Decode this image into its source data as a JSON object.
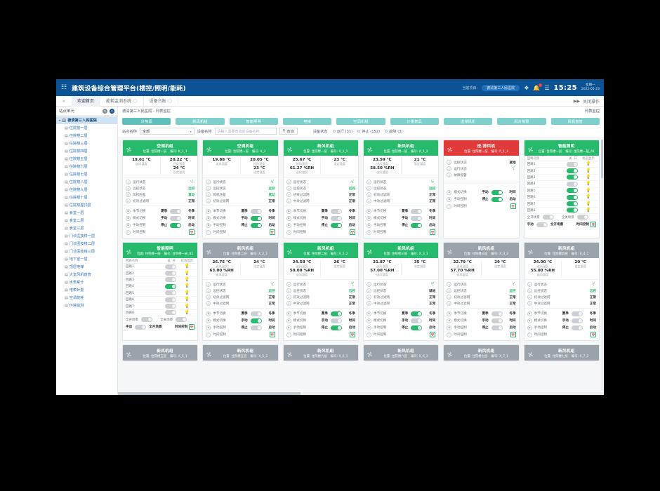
{
  "topbar": {
    "menu_icon": "menu-icon",
    "title": "建筑设备综合管理平台(楼控/照明/能耗)",
    "project_label": "当前项目:",
    "project_name": "德清第三人民医院",
    "fullscreen_icon": "fullscreen-icon",
    "bell_icon": "bell-icon",
    "list_icon": "list-icon",
    "clock": "15:25",
    "weekday": "星期一",
    "date": "2022-05-23"
  },
  "tabstrip": {
    "collapse_icon": "collapse-left-icon",
    "tabs": [
      {
        "label": "欢迎首页",
        "closable": false,
        "active": true
      },
      {
        "label": "能耗监测系统",
        "closable": true,
        "active": false
      },
      {
        "label": "设备台账",
        "closable": true,
        "active": false
      }
    ],
    "right_icon": "forward-icon",
    "right_label": "关闭操作"
  },
  "sidebar": {
    "header": "站点单元",
    "refresh_icon": "refresh-icon",
    "search_icon": "search-icon",
    "root": "德清第三人民医院",
    "items": [
      "住院楼一层",
      "住院楼二层",
      "住院楼三层",
      "住院楼四层",
      "住院楼五层",
      "住院楼六层",
      "住院楼七层",
      "住院楼八层",
      "住院楼九层",
      "住院楼十层",
      "住院楼屋顶层",
      "食堂一层",
      "食堂二层",
      "食堂三层",
      "门诊医技楼一层",
      "门诊医技楼二层",
      "门诊医技楼三层",
      "地下室一层",
      "顶层电梯",
      "大堂风机盘管",
      "水表累计",
      "电表计量",
      "空调能耗",
      "环境监测"
    ]
  },
  "breadcrumb": {
    "path": "德清第三人民医院 - 列表监控",
    "right": "列表监控"
  },
  "toolbar": {
    "categories": [
      {
        "label": "冷热源",
        "selected": true
      },
      {
        "label": "新风机组",
        "selected": false
      },
      {
        "label": "智能照明",
        "selected": false
      },
      {
        "label": "电梯",
        "selected": false
      },
      {
        "label": "空调机组",
        "selected": false
      },
      {
        "label": "计量表具",
        "selected": false
      },
      {
        "label": "送排风机",
        "selected": false
      },
      {
        "label": "风冷热泵",
        "selected": false
      },
      {
        "label": "风机盘管",
        "selected": false
      }
    ],
    "site_label": "站点名称",
    "site_value": "全部",
    "device_label": "设备名称",
    "device_placeholder": "请输入需要查询的设备名称",
    "search_button": "查询",
    "search_icon": "search-icon",
    "status_label": "设备状态",
    "statuses": [
      {
        "label": "运行 (31)"
      },
      {
        "label": "停止 (152)"
      },
      {
        "label": "故障 (3)"
      }
    ]
  },
  "labels": {
    "pos": "位置:",
    "code": "编号:",
    "supply_temp": "送风温度",
    "return_temp": "回风温度",
    "set_temp": "设定温度",
    "supply_hum": "送风湿度",
    "run_state": "运行状态",
    "remote_state": "远控状态",
    "fan_press": "风机压差",
    "primary_filter": "初效过滤网",
    "medium_filter": "中效过滤网",
    "fault_alarm": "故障报警",
    "season_switch": "季节切换",
    "mode_switch": "模式切换",
    "manual_ctrl": "手动控制",
    "time_ctrl": "时间控制",
    "summer": "夏季",
    "winter": "冬季",
    "manual": "手动",
    "timed": "时间",
    "stop": "停止",
    "start": "启动",
    "loop_name": "回路名称",
    "off": "关",
    "on": "开",
    "state_display": "状态显示",
    "all_on_scene": "全开场景",
    "all_off_scene": "全关场景"
  },
  "cards_row1": [
    {
      "kind": "ahu",
      "title": "空调机组",
      "headerColor": "green",
      "pos": "住院楼一层",
      "code": "K_1_1",
      "t1": "19.61 ℃",
      "t1label": "送风温度",
      "t2": "20.22 ℃",
      "t2label": "回风温度",
      "t3": "24 ℃",
      "t3label": "设定温度",
      "run_icon": "fan-running-icon",
      "remote": "远控",
      "fanpress": "直动",
      "pfilter": "正常",
      "season_on": false,
      "mode_on": false,
      "manual_on": true
    },
    {
      "kind": "ahu",
      "title": "空调机组",
      "headerColor": "green",
      "pos": "住院楼一层",
      "code": "K_2",
      "t1": "19.88 ℃",
      "t1label": "送风温度",
      "t2": "20.05 ℃",
      "t2label": "回风温度",
      "t3": "23 ℃",
      "t3label": "设定温度",
      "run_icon": "fan-running-icon",
      "remote": "远控",
      "fanpress": "直动",
      "pfilter": "正常",
      "season_on": false,
      "mode_on": true,
      "manual_on": true
    },
    {
      "kind": "ahu2",
      "title": "新风机组",
      "headerColor": "green",
      "pos": "住院楼一层",
      "code": "X_1_1",
      "t1": "25.67 ℃",
      "t1label": "送风温度",
      "t1b": "61.27 %RH",
      "t1blabel": "送风湿度",
      "t3": "23 ℃",
      "t3label": "设定温度",
      "run_icon": "fan-running-icon",
      "remote": "远控",
      "pfilter": "正常",
      "mfilter": "正常",
      "season_on": false,
      "mode_on": false,
      "manual_on": true
    },
    {
      "kind": "ahu2",
      "title": "新风机组",
      "headerColor": "green",
      "pos": "住院楼一层",
      "code": "X_1_2",
      "t1": "23.59 ℃",
      "t1label": "送风温度",
      "t1b": "58.50 %RH",
      "t1blabel": "送风湿度",
      "t3": "21 ℃",
      "t3label": "设定温度",
      "run_icon": "fan-running-icon",
      "remote": "远控",
      "pfilter": "正常",
      "mfilter": "正常",
      "season_on": false,
      "mode_on": false,
      "manual_on": true
    },
    {
      "kind": "fan",
      "title": "送/排风机",
      "headerColor": "red",
      "pos": "住院楼一层",
      "code": "P_1_1",
      "remote": "就地",
      "run_icon": "fan-running-icon",
      "mode_on": true,
      "manual_on": true
    },
    {
      "kind": "light",
      "title": "智能照明",
      "headerColor": "green",
      "pos": "住院楼一层",
      "code": "住院楼一层_A1",
      "loops": [
        {
          "name": "回路1",
          "on": false,
          "lamp": false
        },
        {
          "name": "回路2",
          "on": true,
          "lamp": true
        },
        {
          "name": "回路3",
          "on": true,
          "lamp": true
        },
        {
          "name": "回路4",
          "on": false,
          "lamp": false
        },
        {
          "name": "回路5",
          "on": true,
          "lamp": true
        },
        {
          "name": "回路6",
          "on": true,
          "lamp": true
        },
        {
          "name": "回路7",
          "on": true,
          "lamp": true
        },
        {
          "name": "回路8",
          "on": true,
          "lamp": true
        }
      ],
      "scene_on": false,
      "scene_off": false,
      "manual_on": false
    }
  ],
  "cards_row2": [
    {
      "kind": "light",
      "title": "智能照明",
      "headerColor": "green",
      "pos": "住院楼一层",
      "code": "住院楼一层_B1",
      "loops": [
        {
          "name": "回路1",
          "on": false,
          "lamp": false
        },
        {
          "name": "回路2",
          "on": false,
          "lamp": false
        },
        {
          "name": "回路3",
          "on": false,
          "lamp": false
        },
        {
          "name": "回路4",
          "on": true,
          "lamp": true
        },
        {
          "name": "回路5",
          "on": false,
          "lamp": false
        },
        {
          "name": "回路6",
          "on": false,
          "lamp": false
        },
        {
          "name": "回路7",
          "on": false,
          "lamp": false
        },
        {
          "name": "回路8",
          "on": false,
          "lamp": false
        }
      ],
      "scene_on": false,
      "scene_off": false,
      "manual_on": false
    },
    {
      "kind": "ahu2",
      "title": "新风机组",
      "headerColor": "gray",
      "pos": "住院楼二层",
      "code": "X_2_1",
      "t1": "26.75 ℃",
      "t1label": "送风温度",
      "t1b": "63.00 %RH",
      "t1blabel": "送风湿度",
      "t3": "24 ℃",
      "t3label": "设定温度",
      "run_icon": "fan-stopped-icon",
      "remote": "远控",
      "pfilter": "正常",
      "mfilter": "正常",
      "season_on": false,
      "mode_on": true,
      "manual_on": false
    },
    {
      "kind": "ahu2",
      "title": "新风机组",
      "headerColor": "green",
      "pos": "住院楼二层",
      "code": "X_2_2",
      "t1": "24.58 ℃",
      "t1label": "送风温度",
      "t1b": "59.00 %RH",
      "t1blabel": "送风湿度",
      "t3": "26 ℃",
      "t3label": "设定温度",
      "run_icon": "fan-running-icon",
      "remote": "远控",
      "pfilter": "正常",
      "mfilter": "正常",
      "season_on": true,
      "mode_on": false,
      "manual_on": true
    },
    {
      "kind": "ahu2",
      "title": "新风机组",
      "headerColor": "green",
      "pos": "住院楼三层",
      "code": "X_3_1",
      "t1": "21.87 ℃",
      "t1label": "送风温度",
      "t1b": "57.00 %RH",
      "t1blabel": "送风湿度",
      "t3": "35 ℃",
      "t3label": "设定温度",
      "run_icon": "fan-running-icon",
      "remote": "就地",
      "pfilter": "正常",
      "mfilter": "正常",
      "season_on": true,
      "mode_on": false,
      "manual_on": true
    },
    {
      "kind": "ahu2",
      "title": "新风机组",
      "headerColor": "gray",
      "pos": "住院楼三层",
      "code": "X_3_2",
      "t1": "22.79 ℃",
      "t1label": "送风温度",
      "t1b": "57.70 %RH",
      "t1blabel": "送风湿度",
      "t3": "29 ℃",
      "t3label": "设定温度",
      "run_icon": "fan-stopped-icon",
      "remote": "远控",
      "pfilter": "正常",
      "mfilter": "正常",
      "season_on": false,
      "mode_on": false,
      "manual_on": false
    },
    {
      "kind": "ahu2",
      "title": "新风机组",
      "headerColor": "gray",
      "pos": "住院楼四层",
      "code": "X_4_1",
      "t1": "24.00 ℃",
      "t1label": "送风温度",
      "t1b": "55.00 %RH",
      "t1blabel": "送风湿度",
      "t3": "20 ℃",
      "t3label": "设定温度",
      "run_icon": "fan-stopped-icon",
      "remote": "远控",
      "pfilter": "正常",
      "mfilter": "正常",
      "season_on": false,
      "mode_on": false,
      "manual_on": false
    }
  ],
  "cards_row3": [
    {
      "title": "新风机组",
      "headerColor": "gray",
      "pos": "住院楼五层",
      "code": "X_5_1"
    },
    {
      "title": "新风机组",
      "headerColor": "gray",
      "pos": "住院楼五层",
      "code": "X_5_2"
    },
    {
      "title": "新风机组",
      "headerColor": "gray",
      "pos": "住院楼六层",
      "code": "X_6_1"
    },
    {
      "title": "新风机组",
      "headerColor": "gray",
      "pos": "住院楼六层",
      "code": "X_6_2"
    },
    {
      "title": "新风机组",
      "headerColor": "gray",
      "pos": "住院楼七层",
      "code": "X_7_1"
    },
    {
      "title": "新风机组",
      "headerColor": "gray",
      "pos": "住院楼七层",
      "code": "X_7_2"
    }
  ]
}
